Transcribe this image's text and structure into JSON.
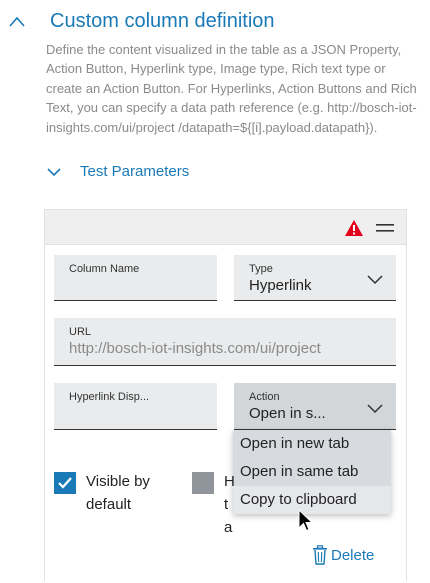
{
  "section": {
    "title": "Custom column definition",
    "description": "Define the content visualized in the table as a JSON Property, Action Button, Hyperlink type, Image type, Rich text type or create an Action Button. For Hyperlinks, Action Buttons and Rich Text, you can specify a data path reference (e.g. http://bosch-iot-insights.com/ui/project /datapath=${[i].payload.datapath})."
  },
  "test_parameters": {
    "label": "Test Parameters"
  },
  "form": {
    "column_name": {
      "label": "Column Name",
      "value": ""
    },
    "type": {
      "label": "Type",
      "value": "Hyperlink"
    },
    "url": {
      "label": "URL",
      "placeholder": "http://bosch-iot-insights.com/ui/project"
    },
    "hyperlink_display": {
      "label": "Hyperlink Disp...",
      "value": ""
    },
    "action": {
      "label": "Action",
      "value": "Open in s...",
      "options": [
        "Open in new tab",
        "Open in same tab",
        "Copy to clipboard"
      ],
      "highlighted_index": 2
    }
  },
  "checkboxes": {
    "visible_by_default": {
      "label": "Visible by default",
      "checked": true
    },
    "second": {
      "label": "H ta",
      "checked": false
    }
  },
  "delete_label": "Delete",
  "colors": {
    "accent": "#1a7ab8",
    "warning": "#e2001a",
    "field_bg": "#e9ebed"
  },
  "icons": [
    "chevron-up-icon",
    "chevron-down-icon",
    "warning-icon",
    "drag-handle-icon",
    "trash-icon",
    "cursor-icon"
  ]
}
